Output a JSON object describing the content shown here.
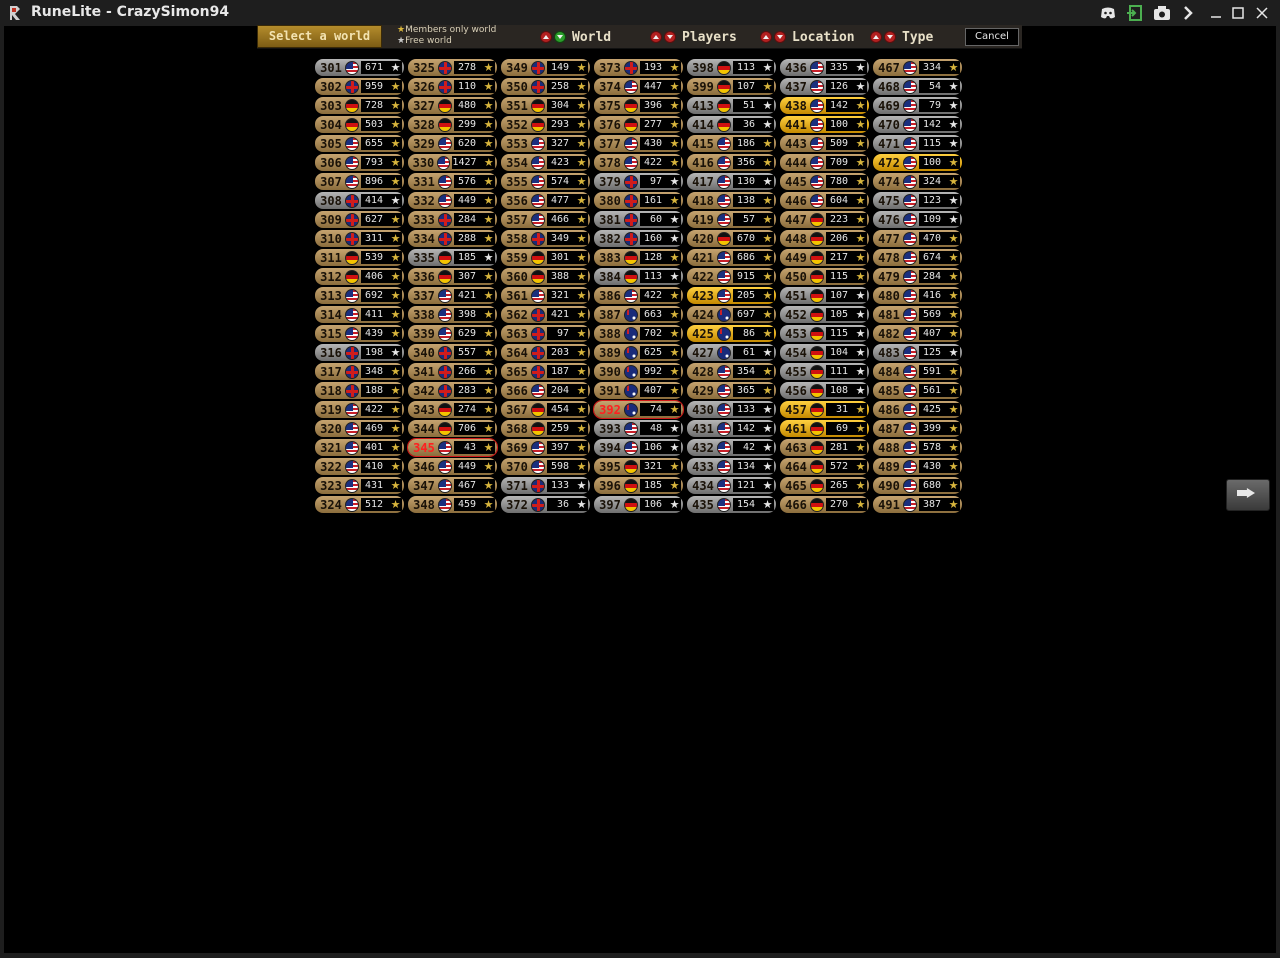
{
  "window": {
    "title": "RuneLite - CrazySimon94"
  },
  "header": {
    "select_world_label": "Select a world",
    "legend_members": "Members only world",
    "legend_free": "Free world",
    "sort_world": "World",
    "sort_players": "Players",
    "sort_location": "Location",
    "sort_type": "Type",
    "cancel_label": "Cancel"
  },
  "worlds": [
    [
      "301",
      "us",
      "671",
      "f"
    ],
    [
      "302",
      "uk",
      "959",
      "m"
    ],
    [
      "303",
      "de",
      "728",
      "m"
    ],
    [
      "304",
      "de",
      "503",
      "m"
    ],
    [
      "305",
      "us",
      "655",
      "m"
    ],
    [
      "306",
      "us",
      "793",
      "m"
    ],
    [
      "307",
      "us",
      "896",
      "m"
    ],
    [
      "308",
      "uk",
      "414",
      "f"
    ],
    [
      "309",
      "uk",
      "627",
      "m"
    ],
    [
      "310",
      "uk",
      "311",
      "m"
    ],
    [
      "311",
      "de",
      "539",
      "m"
    ],
    [
      "312",
      "de",
      "406",
      "m"
    ],
    [
      "313",
      "us",
      "692",
      "m"
    ],
    [
      "314",
      "us",
      "411",
      "m"
    ],
    [
      "315",
      "us",
      "439",
      "m"
    ],
    [
      "316",
      "uk",
      "198",
      "f"
    ],
    [
      "317",
      "uk",
      "348",
      "m"
    ],
    [
      "318",
      "uk",
      "188",
      "m"
    ],
    [
      "319",
      "us",
      "422",
      "m"
    ],
    [
      "320",
      "us",
      "469",
      "m"
    ],
    [
      "321",
      "us",
      "401",
      "m"
    ],
    [
      "322",
      "us",
      "410",
      "m"
    ],
    [
      "323",
      "us",
      "431",
      "m"
    ],
    [
      "324",
      "us",
      "512",
      "m"
    ],
    [
      "325",
      "uk",
      "278",
      "m"
    ],
    [
      "326",
      "uk",
      "110",
      "m"
    ],
    [
      "327",
      "de",
      "480",
      "m"
    ],
    [
      "328",
      "de",
      "299",
      "m"
    ],
    [
      "329",
      "us",
      "620",
      "m"
    ],
    [
      "330",
      "us",
      "1427",
      "m"
    ],
    [
      "331",
      "us",
      "576",
      "m"
    ],
    [
      "332",
      "us",
      "449",
      "m"
    ],
    [
      "333",
      "uk",
      "284",
      "m"
    ],
    [
      "334",
      "uk",
      "288",
      "m"
    ],
    [
      "335",
      "de",
      "185",
      "f"
    ],
    [
      "336",
      "de",
      "307",
      "m"
    ],
    [
      "337",
      "us",
      "421",
      "m"
    ],
    [
      "338",
      "us",
      "398",
      "m"
    ],
    [
      "339",
      "us",
      "629",
      "m"
    ],
    [
      "340",
      "uk",
      "557",
      "m"
    ],
    [
      "341",
      "uk",
      "266",
      "m"
    ],
    [
      "342",
      "uk",
      "283",
      "m"
    ],
    [
      "343",
      "de",
      "274",
      "m"
    ],
    [
      "344",
      "de",
      "706",
      "m"
    ],
    [
      "345",
      "us",
      "43",
      "d"
    ],
    [
      "346",
      "us",
      "449",
      "m"
    ],
    [
      "347",
      "us",
      "467",
      "m"
    ],
    [
      "348",
      "us",
      "459",
      "m"
    ],
    [
      "349",
      "uk",
      "149",
      "m"
    ],
    [
      "350",
      "uk",
      "258",
      "m"
    ],
    [
      "351",
      "de",
      "304",
      "m"
    ],
    [
      "352",
      "de",
      "293",
      "m"
    ],
    [
      "353",
      "us",
      "327",
      "m"
    ],
    [
      "354",
      "us",
      "423",
      "m"
    ],
    [
      "355",
      "us",
      "574",
      "m"
    ],
    [
      "356",
      "us",
      "477",
      "m"
    ],
    [
      "357",
      "us",
      "466",
      "m"
    ],
    [
      "358",
      "uk",
      "349",
      "m"
    ],
    [
      "359",
      "de",
      "301",
      "m"
    ],
    [
      "360",
      "de",
      "388",
      "m"
    ],
    [
      "361",
      "us",
      "321",
      "m"
    ],
    [
      "362",
      "uk",
      "421",
      "m"
    ],
    [
      "363",
      "uk",
      "97",
      "m"
    ],
    [
      "364",
      "uk",
      "203",
      "m"
    ],
    [
      "365",
      "uk",
      "187",
      "m"
    ],
    [
      "366",
      "us",
      "204",
      "m"
    ],
    [
      "367",
      "de",
      "454",
      "m"
    ],
    [
      "368",
      "de",
      "259",
      "m"
    ],
    [
      "369",
      "us",
      "397",
      "m"
    ],
    [
      "370",
      "us",
      "598",
      "m"
    ],
    [
      "371",
      "uk",
      "133",
      "f"
    ],
    [
      "372",
      "uk",
      "36",
      "f"
    ],
    [
      "373",
      "uk",
      "193",
      "m"
    ],
    [
      "374",
      "us",
      "447",
      "m"
    ],
    [
      "375",
      "de",
      "396",
      "m"
    ],
    [
      "376",
      "de",
      "277",
      "m"
    ],
    [
      "377",
      "us",
      "430",
      "m"
    ],
    [
      "378",
      "us",
      "422",
      "m"
    ],
    [
      "379",
      "uk",
      "97",
      "f"
    ],
    [
      "380",
      "uk",
      "161",
      "m"
    ],
    [
      "381",
      "uk",
      "60",
      "f"
    ],
    [
      "382",
      "uk",
      "160",
      "f"
    ],
    [
      "383",
      "de",
      "128",
      "m"
    ],
    [
      "384",
      "de",
      "113",
      "f"
    ],
    [
      "386",
      "us",
      "422",
      "m"
    ],
    [
      "387",
      "au",
      "663",
      "m"
    ],
    [
      "388",
      "au",
      "702",
      "m"
    ],
    [
      "389",
      "au",
      "625",
      "m"
    ],
    [
      "390",
      "au",
      "992",
      "m"
    ],
    [
      "391",
      "au",
      "407",
      "m"
    ],
    [
      "392",
      "au",
      "74",
      "d"
    ],
    [
      "393",
      "us",
      "48",
      "f"
    ],
    [
      "394",
      "us",
      "106",
      "f"
    ],
    [
      "395",
      "de",
      "321",
      "m"
    ],
    [
      "396",
      "de",
      "185",
      "m"
    ],
    [
      "397",
      "de",
      "106",
      "f"
    ],
    [
      "398",
      "de",
      "113",
      "f"
    ],
    [
      "399",
      "de",
      "107",
      "m"
    ],
    [
      "413",
      "de",
      "51",
      "f"
    ],
    [
      "414",
      "de",
      "36",
      "f"
    ],
    [
      "415",
      "us",
      "186",
      "m"
    ],
    [
      "416",
      "us",
      "356",
      "m"
    ],
    [
      "417",
      "us",
      "130",
      "f"
    ],
    [
      "418",
      "us",
      "138",
      "m"
    ],
    [
      "419",
      "us",
      "57",
      "m"
    ],
    [
      "420",
      "de",
      "670",
      "m"
    ],
    [
      "421",
      "us",
      "686",
      "m"
    ],
    [
      "422",
      "us",
      "915",
      "m"
    ],
    [
      "423",
      "us",
      "205",
      "h"
    ],
    [
      "424",
      "au",
      "697",
      "m"
    ],
    [
      "425",
      "au",
      "86",
      "h"
    ],
    [
      "427",
      "au",
      "61",
      "f"
    ],
    [
      "428",
      "us",
      "354",
      "m"
    ],
    [
      "429",
      "us",
      "365",
      "m"
    ],
    [
      "430",
      "us",
      "133",
      "f"
    ],
    [
      "431",
      "us",
      "142",
      "f"
    ],
    [
      "432",
      "us",
      "42",
      "f"
    ],
    [
      "433",
      "us",
      "134",
      "f"
    ],
    [
      "434",
      "us",
      "121",
      "f"
    ],
    [
      "435",
      "us",
      "154",
      "f"
    ],
    [
      "436",
      "us",
      "335",
      "f"
    ],
    [
      "437",
      "us",
      "126",
      "f"
    ],
    [
      "438",
      "us",
      "142",
      "h"
    ],
    [
      "441",
      "us",
      "100",
      "h"
    ],
    [
      "443",
      "us",
      "509",
      "m"
    ],
    [
      "444",
      "us",
      "709",
      "m"
    ],
    [
      "445",
      "us",
      "780",
      "m"
    ],
    [
      "446",
      "us",
      "604",
      "m"
    ],
    [
      "447",
      "de",
      "223",
      "m"
    ],
    [
      "448",
      "de",
      "206",
      "m"
    ],
    [
      "449",
      "de",
      "217",
      "m"
    ],
    [
      "450",
      "de",
      "115",
      "m"
    ],
    [
      "451",
      "de",
      "107",
      "f"
    ],
    [
      "452",
      "de",
      "105",
      "f"
    ],
    [
      "453",
      "de",
      "115",
      "f"
    ],
    [
      "454",
      "de",
      "104",
      "f"
    ],
    [
      "455",
      "de",
      "111",
      "f"
    ],
    [
      "456",
      "de",
      "108",
      "f"
    ],
    [
      "457",
      "de",
      "31",
      "h"
    ],
    [
      "461",
      "de",
      "69",
      "h"
    ],
    [
      "463",
      "de",
      "281",
      "m"
    ],
    [
      "464",
      "de",
      "572",
      "m"
    ],
    [
      "465",
      "de",
      "265",
      "m"
    ],
    [
      "466",
      "de",
      "270",
      "m"
    ],
    [
      "467",
      "us",
      "334",
      "m"
    ],
    [
      "468",
      "us",
      "54",
      "f"
    ],
    [
      "469",
      "us",
      "79",
      "f"
    ],
    [
      "470",
      "us",
      "142",
      "f"
    ],
    [
      "471",
      "us",
      "115",
      "f"
    ],
    [
      "472",
      "us",
      "100",
      "h"
    ],
    [
      "474",
      "us",
      "324",
      "m"
    ],
    [
      "475",
      "us",
      "123",
      "f"
    ],
    [
      "476",
      "us",
      "109",
      "f"
    ],
    [
      "477",
      "us",
      "470",
      "m"
    ],
    [
      "478",
      "us",
      "674",
      "m"
    ],
    [
      "479",
      "us",
      "284",
      "m"
    ],
    [
      "480",
      "us",
      "416",
      "m"
    ],
    [
      "481",
      "us",
      "569",
      "m"
    ],
    [
      "482",
      "us",
      "407",
      "m"
    ],
    [
      "483",
      "us",
      "125",
      "f"
    ],
    [
      "484",
      "us",
      "591",
      "m"
    ],
    [
      "485",
      "us",
      "561",
      "m"
    ],
    [
      "486",
      "us",
      "425",
      "m"
    ],
    [
      "487",
      "us",
      "399",
      "m"
    ],
    [
      "488",
      "us",
      "578",
      "m"
    ],
    [
      "489",
      "us",
      "430",
      "m"
    ],
    [
      "490",
      "us",
      "680",
      "m"
    ],
    [
      "491",
      "us",
      "387",
      "m"
    ]
  ]
}
